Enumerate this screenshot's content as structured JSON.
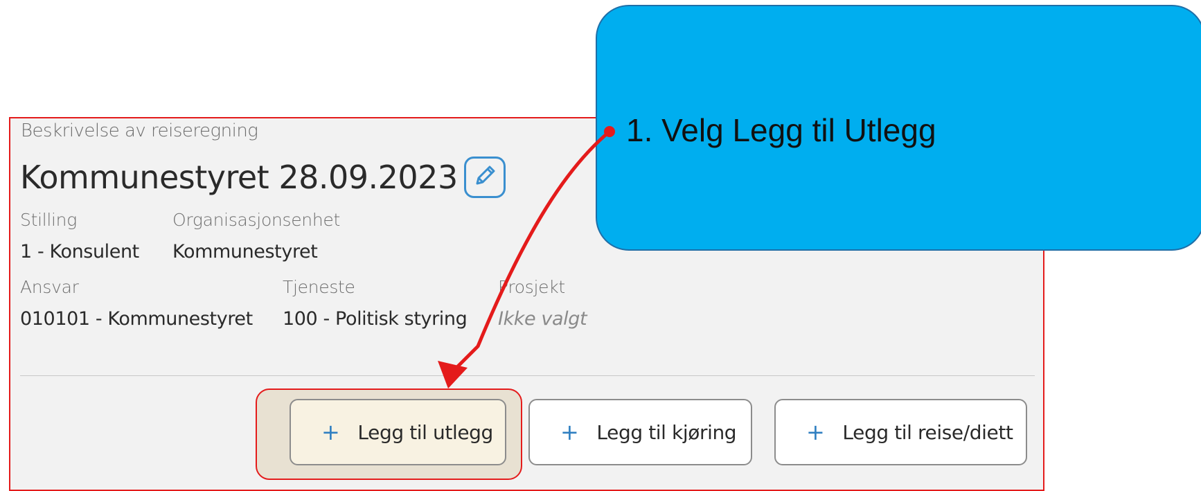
{
  "panel": {
    "caption": "Beskrivelse av reiseregning",
    "title": "Kommunestyret 28.09.2023",
    "fields_row1": [
      {
        "label": "Stilling",
        "value": "1 - Konsulent"
      },
      {
        "label": "Organisasjonsenhet",
        "value": "Kommunestyret"
      }
    ],
    "fields_row2": [
      {
        "label": "Ansvar",
        "value": "010101 - Kommunestyret"
      },
      {
        "label": "Tjeneste",
        "value": "100 - Politisk styring"
      },
      {
        "label": "Prosjekt",
        "value": "Ikke valgt"
      }
    ]
  },
  "actions": [
    {
      "label": "Legg til utlegg",
      "icon": "plus-icon"
    },
    {
      "label": "Legg til kjøring",
      "icon": "plus-icon"
    },
    {
      "label": "Legg til reise/diett",
      "icon": "plus-icon"
    }
  ],
  "callout": {
    "text": "1. Velg Legg til Utlegg"
  },
  "colors": {
    "panel_border": "#e41b1b",
    "accent_blue": "#2f7fc1",
    "callout_fill": "#00aeef",
    "arrow": "#e41b1b"
  }
}
